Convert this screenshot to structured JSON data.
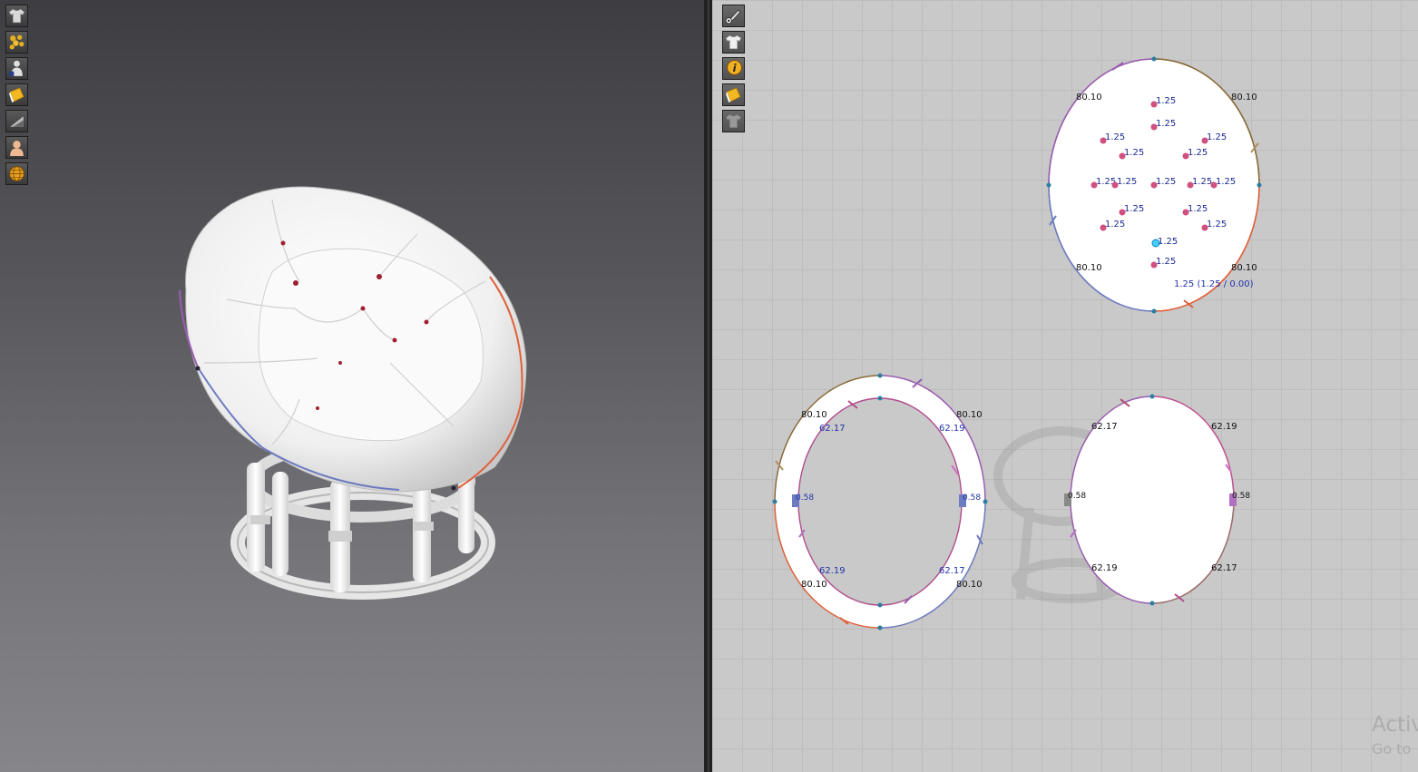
{
  "toolbar3d": {
    "items": [
      {
        "icon": "garment-shirt-icon"
      },
      {
        "icon": "particles-icon"
      },
      {
        "icon": "avatar-pose-icon"
      },
      {
        "icon": "texture-fabric-icon"
      },
      {
        "icon": "shading-icon"
      },
      {
        "icon": "avatar-skin-icon"
      },
      {
        "icon": "environment-globe-icon"
      }
    ]
  },
  "toolbar2d": {
    "items": [
      {
        "icon": "show-pen-icon"
      },
      {
        "icon": "show-garment-icon"
      },
      {
        "icon": "info-icon",
        "glyph": "i"
      },
      {
        "icon": "texture-fabric-icon"
      },
      {
        "icon": "show-avatar-shirt-icon"
      }
    ]
  },
  "patterns": {
    "oval_top": {
      "corner_labels": [
        "80.10",
        "80.10",
        "80.10",
        "80.10"
      ],
      "button_label": "1.25",
      "selected_label": "1.25",
      "measure": "1.25 (1.25 / 0.00)"
    },
    "ring": {
      "outer_labels": [
        "80.10",
        "80.10",
        "80.10",
        "80.10"
      ],
      "inner_labels": [
        "62.17",
        "62.19",
        "62.19",
        "62.17"
      ],
      "side_labels": [
        "0.58",
        "0.58"
      ]
    },
    "oval_right": {
      "labels": [
        "62.17",
        "62.19",
        "62.19",
        "62.17"
      ],
      "side_labels": [
        "0.58",
        "0.58"
      ]
    }
  },
  "colors": {
    "seam_brown": "#8b6b3a",
    "seam_orange": "#e0603a",
    "seam_blue": "#6d7bc0",
    "seam_purple": "#9a5db0",
    "button_pink": "#d05080",
    "measure_blue": "#2233aa",
    "point_teal": "#2a7fa0"
  },
  "watermark": {
    "line1": "Activ",
    "line2": "Go to"
  }
}
